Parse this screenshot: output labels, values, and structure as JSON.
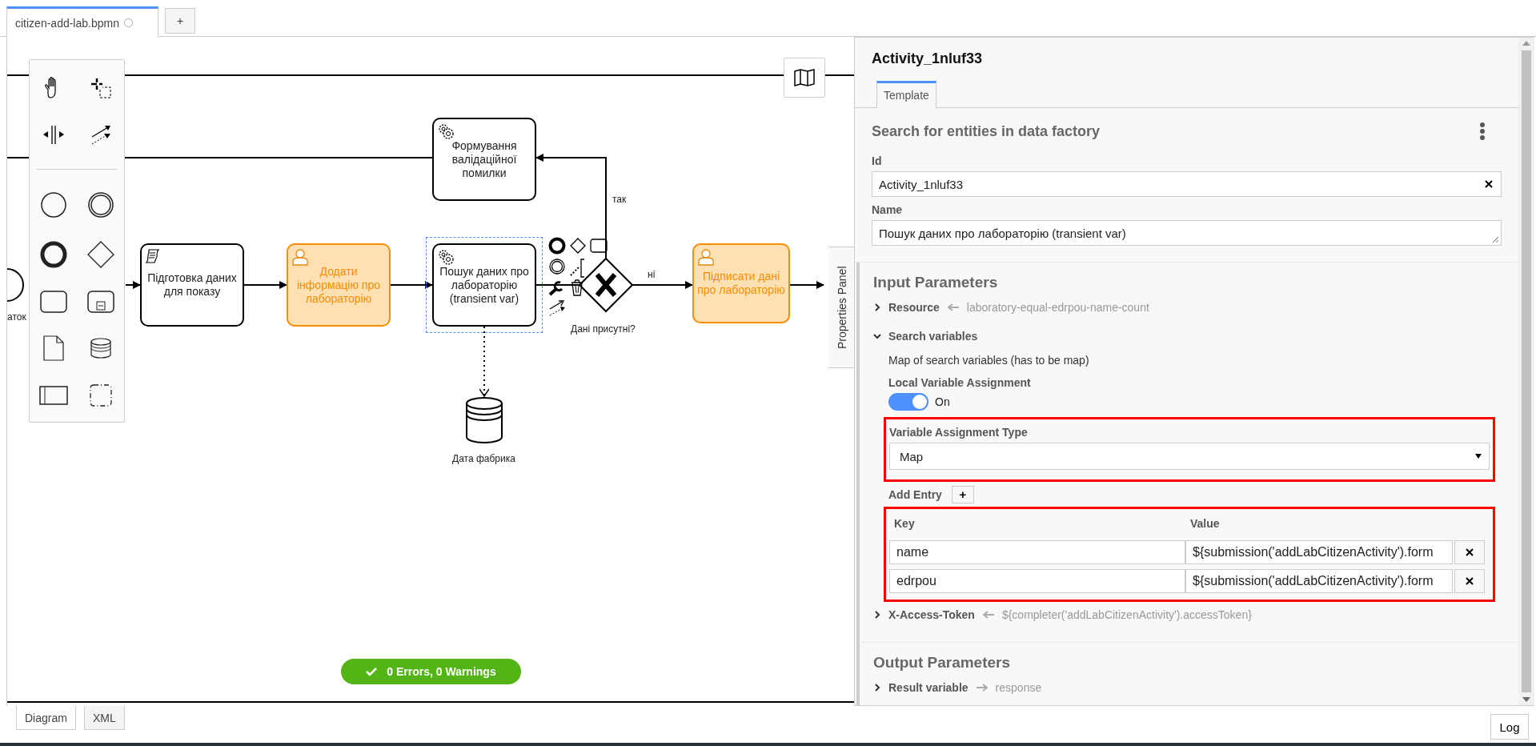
{
  "file_tabs": [
    {
      "label": "citizen-add-lab.bpmn",
      "selected": true,
      "unsaved": true
    }
  ],
  "new_tab_button": "+",
  "diagram": {
    "start_event_label": "аток",
    "tasks": [
      {
        "kind": "service",
        "label": "Формування валідаційної помилки",
        "highlighted": false,
        "selected": false
      },
      {
        "kind": "script",
        "label": "Підготовка даних для показу",
        "highlighted": false,
        "selected": false
      },
      {
        "kind": "user",
        "label": "Додати інформацію про лабораторію",
        "highlighted": true,
        "selected": false
      },
      {
        "kind": "service",
        "label": "Пошук даних про лабораторію (transient var)",
        "highlighted": false,
        "selected": true
      },
      {
        "kind": "user",
        "label": "Підписати дані про лабораторію",
        "highlighted": true,
        "selected": false
      }
    ],
    "gateway_label": "Дані присутні?",
    "flow_labels": [
      "так",
      "ні"
    ],
    "data_store_label": "Дата фабрика",
    "validation": "0 Errors, 0 Warnings",
    "panel_toggle": "Properties Panel"
  },
  "properties": {
    "title": "Activity_1nluf33",
    "tabs": [
      {
        "label": "Template",
        "selected": true
      }
    ],
    "group_title": "Search for entities in data factory",
    "fields": [
      {
        "kind": "input",
        "label": "Id",
        "value": "Activity_1nluf33"
      },
      {
        "kind": "textarea",
        "label": "Name",
        "value": "Пошук даних про лабораторію (transient var)"
      }
    ],
    "input_parameters": {
      "title": "Input Parameters",
      "items": [
        {
          "label": "Resource",
          "value": "laboratory-equal-edrpou-name-count",
          "expanded": false
        },
        {
          "label": "Search variables",
          "expanded": true,
          "description": "Map of search variables (has to be map)",
          "local_assignment": {
            "label": "Local Variable Assignment",
            "on": true,
            "state_label": "On"
          },
          "assignment_type": {
            "label": "Variable Assignment Type",
            "value": "Map",
            "highlighted": true
          },
          "add_entry": "Add Entry",
          "add_button": "+",
          "columns": [
            "Key",
            "Value"
          ],
          "entries_highlighted": true,
          "entries": [
            {
              "key": "name",
              "value": "${submission('addLabCitizenActivity').form"
            },
            {
              "key": "edrpou",
              "value": "${submission('addLabCitizenActivity').form"
            }
          ]
        },
        {
          "label": "X-Access-Token",
          "value": "${completer('addLabCitizenActivity').accessToken}",
          "expanded": false
        }
      ]
    },
    "output_parameters": {
      "title": "Output Parameters",
      "items": [
        {
          "label": "Result variable",
          "value": "response",
          "expanded": false
        }
      ]
    }
  },
  "view_tabs": [
    {
      "label": "Diagram",
      "selected": true
    },
    {
      "label": "XML",
      "selected": false
    }
  ],
  "log_button": "Log"
}
